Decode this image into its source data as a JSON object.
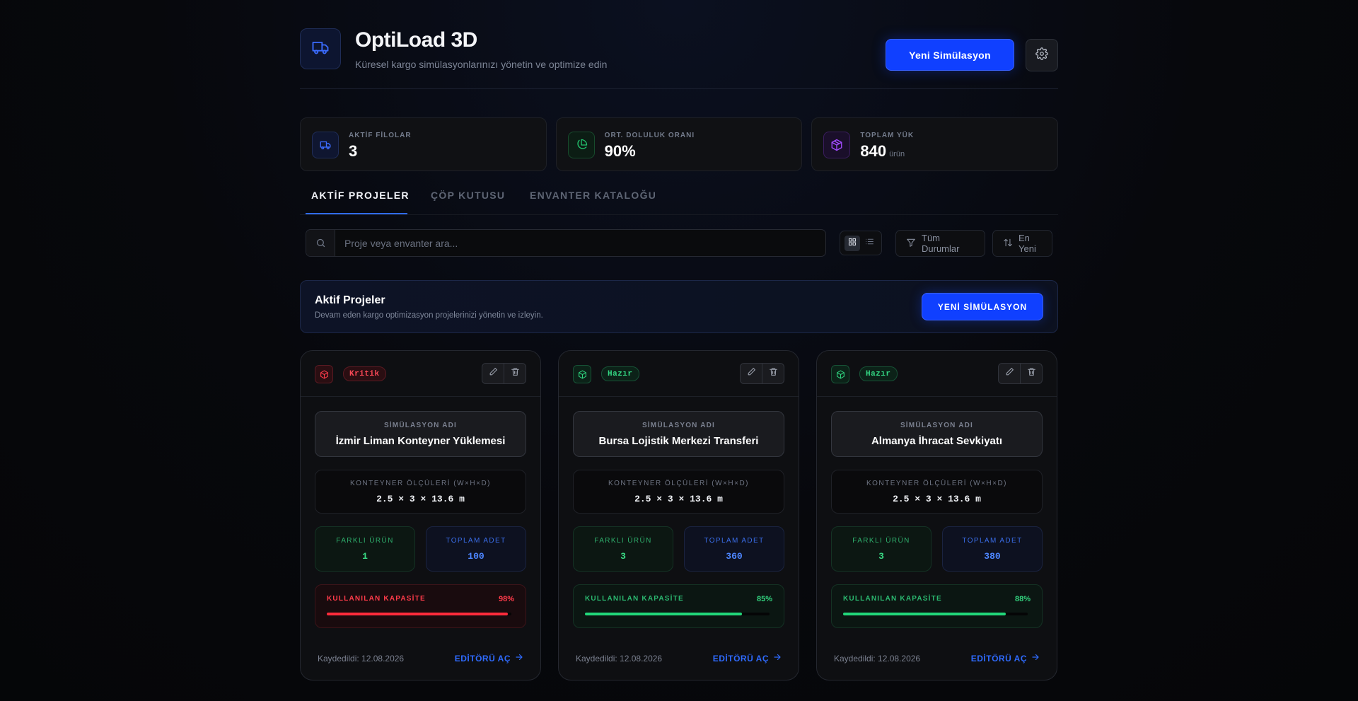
{
  "header": {
    "title": "OptiLoad 3D",
    "subtitle": "Küresel kargo simülasyonlarınızı yönetin ve optimize edin",
    "new_button": "Yeni Simülasyon"
  },
  "stats": [
    {
      "label": "AKTİF FİLOLAR",
      "value": "3",
      "unit": "",
      "icon": "truck-icon",
      "color": "#3b6cff"
    },
    {
      "label": "ORT. DOLULUK ORANI",
      "value": "90%",
      "unit": "",
      "icon": "pie-chart-icon",
      "color": "#22c46e"
    },
    {
      "label": "TOPLAM YÜK",
      "value": "840",
      "unit": "ürün",
      "icon": "package-icon",
      "color": "#a24bff"
    }
  ],
  "tabs": [
    {
      "label": "AKTİF PROJELER",
      "active": true
    },
    {
      "label": "ÇÖP KUTUSU",
      "active": false
    },
    {
      "label": "ENVANTER KATALOĞU",
      "active": false
    }
  ],
  "toolbar": {
    "search_placeholder": "Proje veya envanter ara...",
    "status_filter": "Tüm Durumlar",
    "sort": "En Yeni"
  },
  "banner": {
    "title": "Aktif Projeler",
    "subtitle": "Devam eden kargo optimizasyon projelerinizi yönetin ve izleyin.",
    "button": "YENİ SİMÜLASYON"
  },
  "card_labels": {
    "name": "SİMÜLASYON ADI",
    "dimensions": "KONTEYNER ÖLÇÜLERİ (W×H×D)",
    "distinct": "FARKLI ÜRÜN",
    "total": "TOPLAM ADET",
    "capacity": "KULLANILAN KAPASİTE",
    "open": "EDİTÖRÜ AÇ"
  },
  "cards": [
    {
      "status": "Kritik",
      "status_type": "critical",
      "name": "İzmir Liman Konteyner Yüklemesi",
      "dimensions": "2.5 × 3 × 13.6 m",
      "distinct": "1",
      "total": "100",
      "capacity": "98%",
      "capacity_value": 0.98,
      "saved": "Kaydedildi: 12.08.2026"
    },
    {
      "status": "Hazır",
      "status_type": "ready",
      "name": "Bursa Lojistik Merkezi Transferi",
      "dimensions": "2.5 × 3 × 13.6 m",
      "distinct": "3",
      "total": "360",
      "capacity": "85%",
      "capacity_value": 0.85,
      "saved": "Kaydedildi: 12.08.2026"
    },
    {
      "status": "Hazır",
      "status_type": "ready",
      "name": "Almanya İhracat Sevkiyatı",
      "dimensions": "2.5 × 3 × 13.6 m",
      "distinct": "3",
      "total": "380",
      "capacity": "88%",
      "capacity_value": 0.88,
      "saved": "Kaydedildi: 12.08.2026"
    }
  ]
}
